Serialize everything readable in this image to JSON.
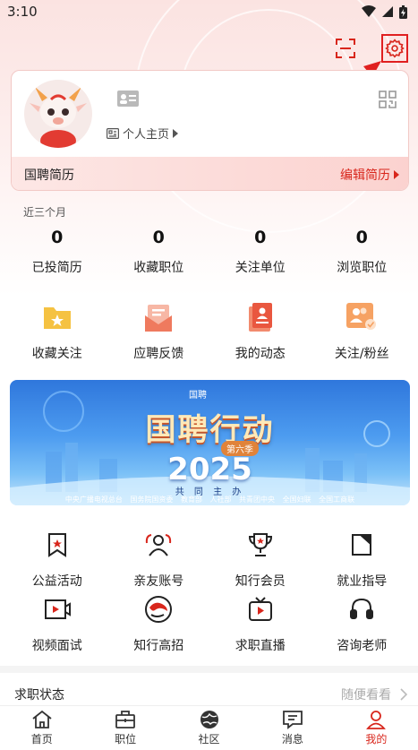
{
  "status_bar": {
    "time": "3:10"
  },
  "profile": {
    "homepage_label": "个人主页",
    "resume_title": "国聘简历",
    "edit_resume_label": "编辑简历"
  },
  "stats": {
    "period_label": "近三个月",
    "items": [
      {
        "value": "0",
        "label": "已投简历"
      },
      {
        "value": "0",
        "label": "收藏职位"
      },
      {
        "value": "0",
        "label": "关注单位"
      },
      {
        "value": "0",
        "label": "浏览职位"
      }
    ]
  },
  "shortcuts": [
    {
      "label": "收藏关注",
      "icon": "folder-star-icon"
    },
    {
      "label": "应聘反馈",
      "icon": "feedback-envelope-icon"
    },
    {
      "label": "我的动态",
      "icon": "post-icon"
    },
    {
      "label": "关注/粉丝",
      "icon": "followers-icon"
    }
  ],
  "banner": {
    "title": "国聘行动",
    "season": "第六季",
    "year": "2025",
    "subtitle": "共 同 主 办",
    "orgs": "中央广播电视总台 国务院国资委 教育部 人社部 共青团中央 全国妇联 全国工商联",
    "logo_text": "国聘"
  },
  "services": {
    "row1": [
      {
        "label": "公益活动",
        "icon": "bookmark-star-icon"
      },
      {
        "label": "亲友账号",
        "icon": "family-account-icon"
      },
      {
        "label": "知行会员",
        "icon": "trophy-icon"
      },
      {
        "label": "就业指导",
        "icon": "guide-book-icon"
      }
    ],
    "row2": [
      {
        "label": "视频面试",
        "icon": "video-interview-icon"
      },
      {
        "label": "知行高招",
        "icon": "zhixing-logo-icon"
      },
      {
        "label": "求职直播",
        "icon": "live-tv-icon"
      },
      {
        "label": "咨询老师",
        "icon": "headset-icon"
      }
    ]
  },
  "job_status": {
    "title": "求职状态",
    "hint": "随便看看"
  },
  "tabbar": [
    {
      "label": "首页",
      "icon": "home-icon"
    },
    {
      "label": "职位",
      "icon": "briefcase-icon"
    },
    {
      "label": "社区",
      "icon": "community-globe-icon"
    },
    {
      "label": "消息",
      "icon": "message-icon"
    },
    {
      "label": "我的",
      "icon": "profile-icon",
      "active": true
    }
  ],
  "colors": {
    "accent": "#d8261c",
    "highlight": "#e02020"
  }
}
